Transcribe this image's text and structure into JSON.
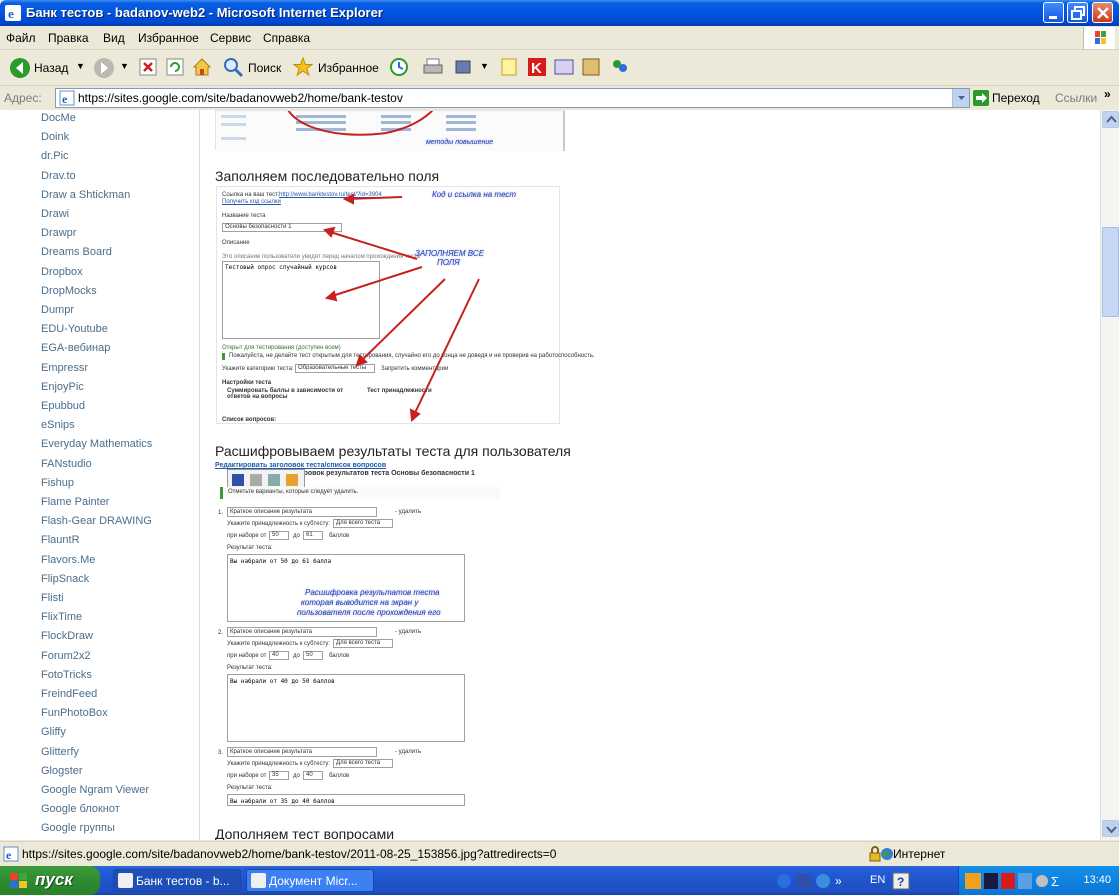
{
  "window": {
    "title": "Банк тестов - badanov-web2 - Microsoft Internet Explorer"
  },
  "menu": [
    "Файл",
    "Правка",
    "Вид",
    "Избранное",
    "Сервис",
    "Справка"
  ],
  "toolbar": {
    "back": "Назад",
    "search": "Поиск",
    "favorites": "Избранное"
  },
  "address": {
    "label": "Адрес:",
    "url": "https://sites.google.com/site/badanovweb2/home/bank-testov",
    "go": "Переход",
    "links": "Ссылки"
  },
  "sidebar": {
    "items": [
      "DocMe",
      "Doink",
      "dr.Pic",
      "Drav.to",
      "Draw a Shtickman",
      "Drawi",
      "Drawpr",
      "Dreams Board",
      "Dropbox",
      "DropMocks",
      "Dumpr",
      "EDU-Youtube",
      "EGA-вебинар",
      "Empressr",
      "EnjoyPic",
      "Epubbud",
      "eSnips",
      "Everyday Mathematics",
      "FANstudio",
      "Fishup",
      "Flame Painter",
      "Flash-Gear DRAWING",
      "FlauntR",
      "Flavors.Me",
      "FlipSnack",
      "Flisti",
      "FlixTime",
      "FlockDraw",
      "Forum2x2",
      "FotoTricks",
      "FreindFeed",
      "FunPhotoBox",
      "Gliffy",
      "Glitterfy",
      "Glogster",
      "Google Ngram Viewer",
      "Google блокнот",
      "Google группы"
    ]
  },
  "main": {
    "heading1": "Заполняем последовательно поля",
    "heading2": "Расшифровываем результаты теста для пользователя",
    "heading3": "Дополняем тест вопросами",
    "shot1": {
      "link_label": "Ссылка на ваш тест:",
      "link_url": "http://www.banktestov.ru/test/?id=3904",
      "get_code": "Получить код ссылки",
      "ann_code": "Код и ссылка на тест",
      "name_label": "Название теста",
      "name_value": "Основы безопасности 1",
      "desc_label": "Описание",
      "desc_hint": "Это описание пользователи увидят перед началом прохождения теста",
      "desc_value": "Тестовый опрос случайный курсов",
      "ann_fill": "ЗАПОЛНЯЕМ ВСЕ",
      "ann_fill2": "ПОЛЯ",
      "open_cb": "Открыт для тестирования (доступен всем)",
      "warn": "Пожалуйста, не делайте тест открытым для тестирования, случайно его до конца не доведя и не проверив на работоспособность.",
      "cat_label": "Укажите категорию теста:",
      "cat_value": "Образовательные тесты",
      "cat_cb": "Запретить комментарии",
      "settings": "Настройки теста",
      "opt1": "Суммировать баллы в зависимости от ответов на вопросы",
      "opt2": "Тест принадлежности",
      "questions": "Список вопросов:",
      "top_note": "методы повышение"
    },
    "shot2": {
      "edit_links": "Редактировать заголовок теста/список вопросов",
      "title": "Расшифровок результатов теста Основы безопасности 1",
      "mark": "Отметьте варианты, которые следует удалить.",
      "delete": "- удалить",
      "subtest_label": "Укажите принадлежность к субтесту:",
      "subtest_value": "Для всего теста",
      "score_prefix": "при наборе от",
      "score_mid": "до",
      "score_suffix": "баллов",
      "result_label": "Результат теста:",
      "ann": [
        "Расшифровка результатов теста",
        "которая выводится на экран у",
        "пользователя после прохождения его"
      ],
      "results": [
        {
          "num": "1.",
          "short": "Краткое описание результата",
          "from": "50",
          "to": "61",
          "text": "Вы набрали от 50 до 61 балла"
        },
        {
          "num": "2.",
          "short": "Краткое описание результата",
          "from": "40",
          "to": "50",
          "text": "Вы набрали от 40 до 50 баллов"
        },
        {
          "num": "3.",
          "short": "Краткое описание результата",
          "from": "35",
          "to": "40",
          "text": "Вы набрали от 35 до 40 баллов"
        }
      ]
    }
  },
  "status": {
    "url": "https://sites.google.com/site/badanovweb2/home/bank-testov/2011-08-25_153856.jpg?attredirects=0",
    "zone": "Интернет"
  },
  "taskbar": {
    "start": "пуск",
    "tasks": [
      "Банк тестов - b...",
      "Документ Micr..."
    ],
    "lang": "EN",
    "clock": "13:40"
  }
}
